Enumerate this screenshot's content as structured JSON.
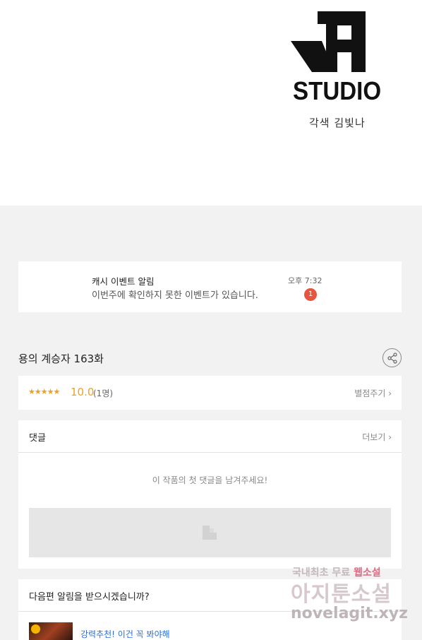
{
  "header": {
    "logo_text": "STUDIO",
    "credit": "각색 김빛나"
  },
  "notification": {
    "title": "캐시 이벤트 알림",
    "message": "이번주에 확인하지 못한 이벤트가 있습니다.",
    "time": "오후 7:32",
    "badge_count": "1"
  },
  "episode": {
    "title": "용의 계승자 163화"
  },
  "rating": {
    "stars": "★★★★★",
    "score": "10.0",
    "count": "(1명)",
    "rate_button": "별점주기 ›"
  },
  "comments": {
    "title": "댓글",
    "more": "더보기 ›",
    "empty_message": "이 작품의 첫 댓글을 남겨주세요!"
  },
  "next_alert": {
    "question": "다음편 알림을 받으시겠습니까?",
    "recommendation": "강력추천! 이건 꼭 봐야해"
  },
  "watermark": {
    "line1_a": "국내최초 무료",
    "line1_b": "웹소설",
    "line2": "아지툰소설",
    "line3": "novelagit.xyz"
  },
  "colors": {
    "accent_star": "#f0a020",
    "badge": "#e8553f",
    "link": "#2a6fd8"
  }
}
